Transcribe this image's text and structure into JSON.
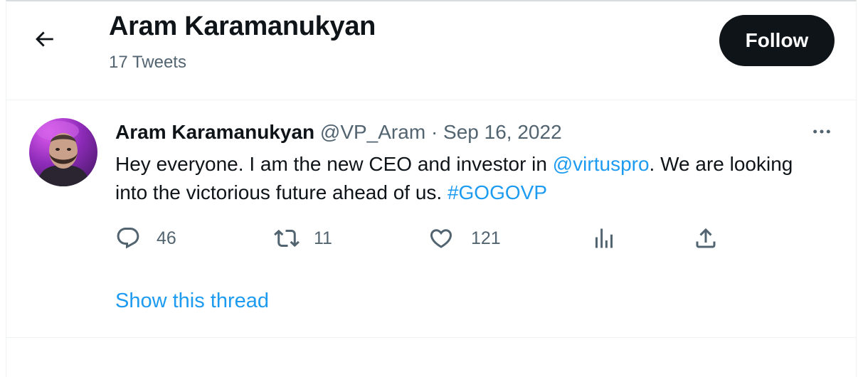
{
  "header": {
    "title": "Aram Karamanukyan",
    "subtitle": "17 Tweets",
    "follow_label": "Follow"
  },
  "tweet": {
    "author_name": "Aram Karamanukyan",
    "handle": "@VP_Aram",
    "separator": "·",
    "date": "Sep 16, 2022",
    "text_before_mention": "Hey everyone. I am the new CEO and investor in ",
    "mention": "@virtuspro",
    "text_after_mention": ". We are looking into the victorious future ahead of us. ",
    "hashtag": "#GOGOVP",
    "actions": {
      "replies": "46",
      "retweets": "11",
      "likes": "121"
    },
    "show_thread_label": "Show this thread"
  },
  "icons": {
    "back": "arrow-left-icon",
    "more": "more-horizontal-icon",
    "reply": "reply-icon",
    "retweet": "retweet-icon",
    "like": "heart-icon",
    "views": "analytics-icon",
    "share": "share-icon"
  },
  "colors": {
    "accent": "#1d9bf0",
    "text": "#0f1419",
    "secondary": "#536471",
    "follow_bg": "#0f1419"
  }
}
